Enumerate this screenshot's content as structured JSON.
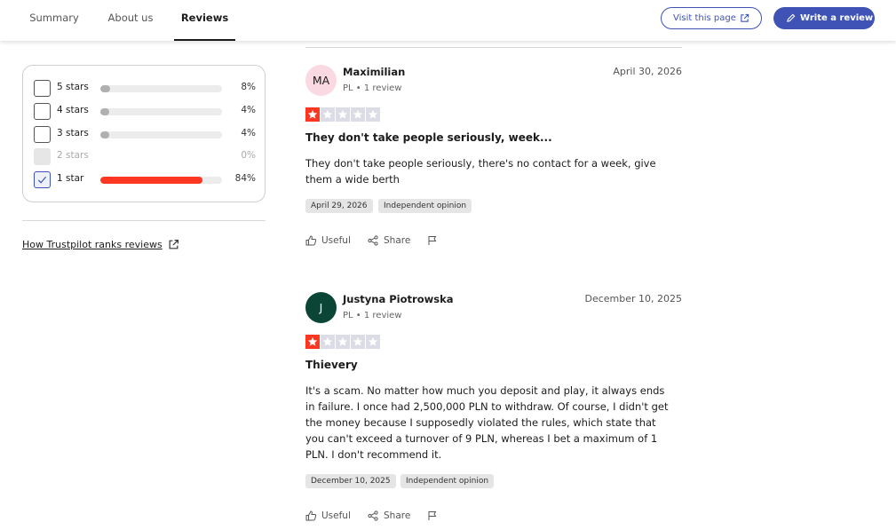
{
  "nav": {
    "tabs": [
      {
        "label": "Summary"
      },
      {
        "label": "About us"
      },
      {
        "label": "Reviews"
      }
    ],
    "visit_label": "Visit this page",
    "write_label": "Write a review"
  },
  "filters": {
    "rows": [
      {
        "label": "5 stars",
        "percent": "8%",
        "fraction": 0.08,
        "state": "unchecked"
      },
      {
        "label": "4 stars",
        "percent": "4%",
        "fraction": 0.04,
        "state": "unchecked"
      },
      {
        "label": "3 stars",
        "percent": "4%",
        "fraction": 0.04,
        "state": "unchecked"
      },
      {
        "label": "2 stars",
        "percent": "0%",
        "fraction": 0.0,
        "state": "disabled"
      },
      {
        "label": "1 star",
        "percent": "84%",
        "fraction": 0.84,
        "state": "checked"
      }
    ],
    "ranks_link": "How Trustpilot ranks reviews"
  },
  "reviews": [
    {
      "initials": "MA",
      "avatar_bg": "#fbd9e3",
      "avatar_color": "#1c1c1c",
      "name": "Maximilian",
      "meta": "PL • 1 review",
      "date": "April 30, 2026",
      "rating": 1,
      "title": "They don't take people seriously, week...",
      "body": "They don't take people seriously, there's no contact for a week, give them a wide berth",
      "experience_date": "April 29, 2026",
      "badge": "Independent opinion",
      "useful_label": "Useful",
      "share_label": "Share"
    },
    {
      "initials": "J",
      "avatar_bg": "#0a4535",
      "avatar_color": "#ffffff",
      "name": "Justyna Piotrowska",
      "meta": "PL • 1 review",
      "date": "December 10, 2025",
      "rating": 1,
      "title": "Thievery",
      "body": "It's a scam. No matter how much you deposit and play, it always ends in failure. I once had 2,500,000 PLN to withdraw. Of course, I didn't get the money because I supposedly violated the rules, which state that you can't exceed a turnover of 9 PLN, whereas I bet a maximum of 1 PLN. I don't recommend it.",
      "experience_date": "December 10, 2025",
      "badge": "Independent opinion",
      "useful_label": "Useful",
      "share_label": "Share"
    }
  ],
  "colors": {
    "accent": "#3e53b5",
    "star_red": "#ff3722",
    "star_empty": "#dcdce6"
  }
}
